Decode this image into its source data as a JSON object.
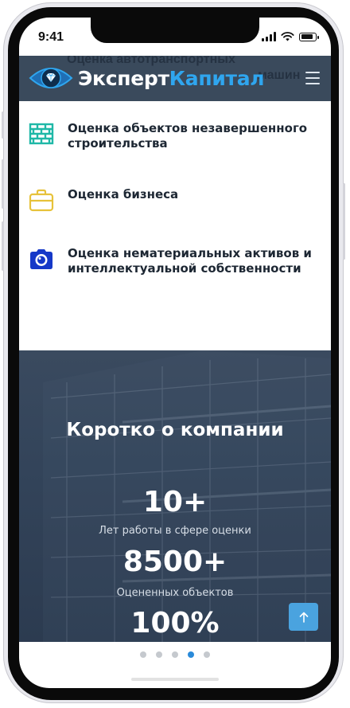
{
  "status_bar": {
    "time": "9:41"
  },
  "header": {
    "ghost_line1": "Оценка автотранспортных",
    "ghost_line2": "машин",
    "logo_part1": "Эксперт",
    "logo_part2": "Капитал",
    "menu_icon": "hamburger-icon"
  },
  "services": [
    {
      "icon": "brick-wall-icon",
      "label": "Оценка объектов незавершенного строительства"
    },
    {
      "icon": "briefcase-icon",
      "label": "Оценка бизнеса"
    },
    {
      "icon": "camera-icon",
      "label": "Оценка нематериальных активов и интеллектуальной собственности"
    }
  ],
  "about": {
    "title": "Коротко о компании",
    "stats": [
      {
        "value": "10+",
        "caption": "Лет работы в сфере оценки"
      },
      {
        "value": "8500+",
        "caption": "Оцененных объектов"
      },
      {
        "value": "100%"
      }
    ]
  },
  "scroll_top_icon": "arrow-up-icon",
  "pagination": {
    "count": 5,
    "active_index": 3
  },
  "colors": {
    "header_bg": "#3a4a5c",
    "brand_blue": "#2fa6ef",
    "about_bg": "#33445a",
    "accent": "#4aa3df",
    "active_dot": "#2a8ad9"
  }
}
